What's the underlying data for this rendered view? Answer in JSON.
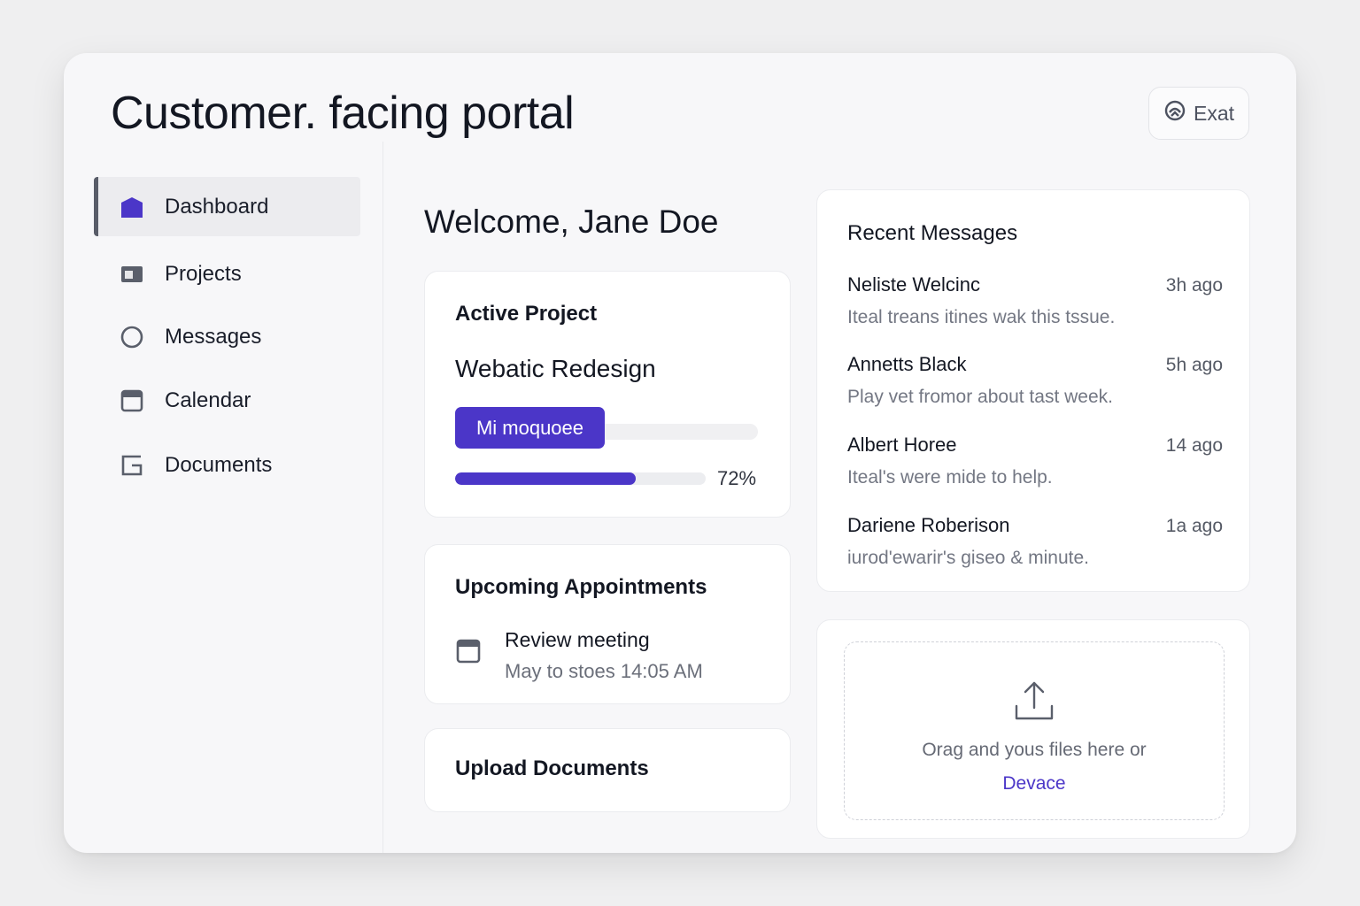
{
  "app": {
    "title": "Customer. facing portal",
    "exit_label": "Exat"
  },
  "sidebar": {
    "items": [
      {
        "label": "Dashboard",
        "icon": "home-icon",
        "active": true
      },
      {
        "label": "Projects",
        "icon": "folder-icon"
      },
      {
        "label": "Messages",
        "icon": "circle-icon"
      },
      {
        "label": "Calendar",
        "icon": "calendar-icon"
      },
      {
        "label": "Documents",
        "icon": "document-icon"
      }
    ]
  },
  "main": {
    "welcome": "Welcome, Jane Doe",
    "active_project": {
      "title": "Active Project",
      "name": "Webatic Redesign",
      "milestone_label": "Mi moquoee",
      "progress": 0.72,
      "progress_label": "72%"
    },
    "appointments": {
      "title": "Upcoming Appointments",
      "items": [
        {
          "title": "Review meeting",
          "time": "May to stoes 14:05 AM"
        }
      ]
    },
    "upload_card": {
      "title": "Upload Documents"
    }
  },
  "messages": {
    "title": "Recent Messages",
    "items": [
      {
        "name": "Neliste Welcinc",
        "time": "3h ago",
        "preview": "Iteal treans itines wak this tssue."
      },
      {
        "name": "Annetts Black",
        "time": "5h ago",
        "preview": "Play vet fromor about tast week."
      },
      {
        "name": "Albert Horee",
        "time": "14 ago",
        "preview": "Iteal's were mide to help."
      },
      {
        "name": "Dariene Roberison",
        "time": "1a ago",
        "preview": "iurod'ewarir's giseo & minute."
      }
    ]
  },
  "dropzone": {
    "text": "Orag and yous files here or",
    "link": "Devace"
  },
  "colors": {
    "accent": "#4b36c8",
    "background": "#efeff0",
    "panel": "#f7f7f9"
  }
}
